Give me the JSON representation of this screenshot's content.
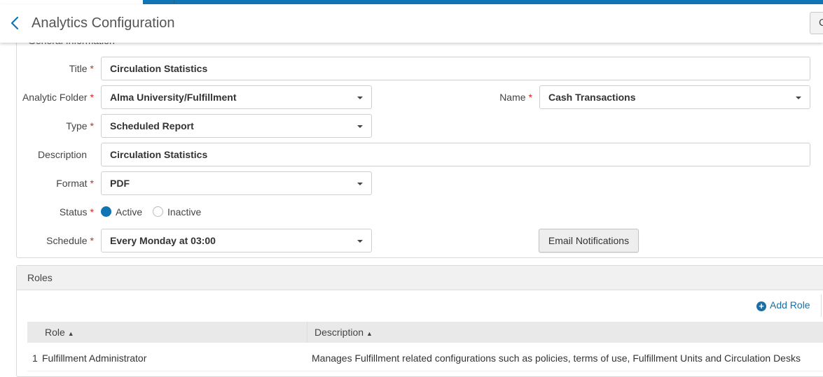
{
  "header": {
    "title": "Analytics Configuration",
    "right_button_label": "C"
  },
  "general": {
    "section_title": "General Information",
    "title": {
      "label": "Title",
      "value": "Circulation Statistics"
    },
    "analytic_folder": {
      "label": "Analytic Folder",
      "value": "Alma University/Fulfillment"
    },
    "name": {
      "label": "Name",
      "value": "Cash Transactions"
    },
    "type": {
      "label": "Type",
      "value": "Scheduled Report"
    },
    "description": {
      "label": "Description",
      "value": "Circulation Statistics"
    },
    "format": {
      "label": "Format",
      "value": "PDF"
    },
    "status": {
      "label": "Status",
      "options": [
        "Active",
        "Inactive"
      ],
      "selected": "Active"
    },
    "schedule": {
      "label": "Schedule",
      "value": "Every Monday at 03:00"
    },
    "email_button": "Email Notifications",
    "required_marker": "*"
  },
  "roles": {
    "section_title": "Roles",
    "add_role_label": "Add Role",
    "columns": [
      "Role",
      "Description"
    ],
    "sort_glyph": "▲",
    "rows": [
      {
        "index": "1",
        "role": "Fulfillment Administrator",
        "description": "Manages Fulfillment related configurations such as policies, terms of use, Fulfillment Units and Circulation Desks"
      }
    ]
  },
  "colors": {
    "accent": "#0f75b5",
    "required": "#dd2222",
    "link": "#1c6ea4"
  }
}
